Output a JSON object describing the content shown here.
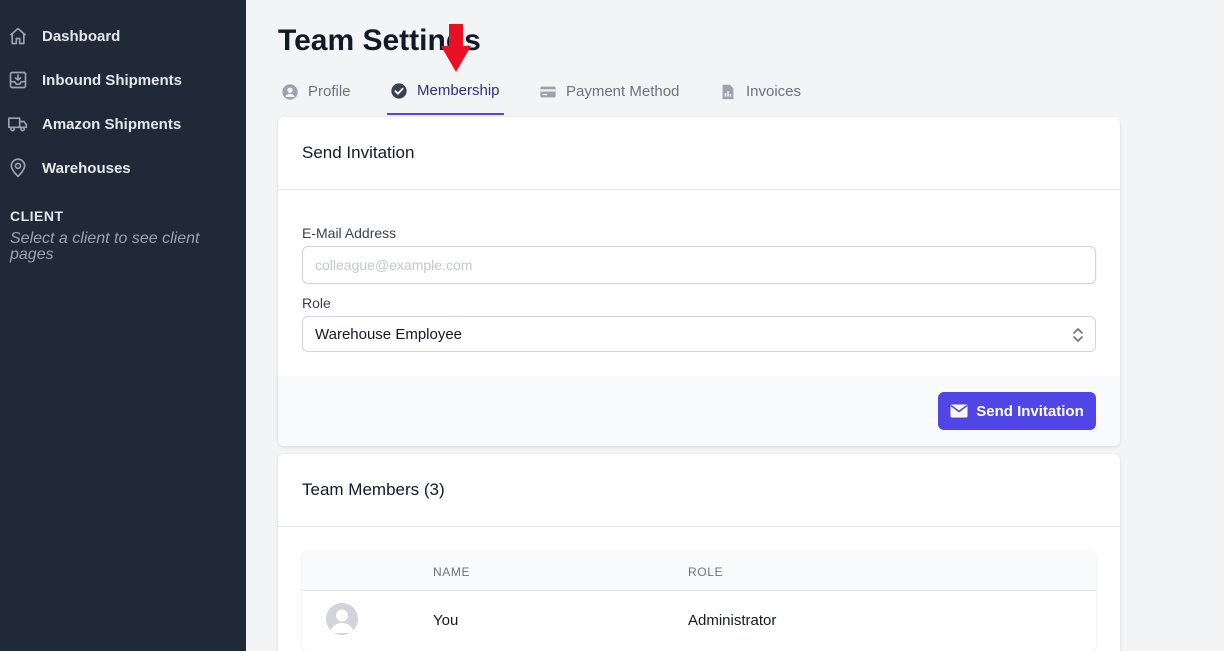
{
  "sidebar": {
    "items": [
      {
        "label": "Dashboard",
        "icon": "home-icon"
      },
      {
        "label": "Inbound Shipments",
        "icon": "inbox-download-icon"
      },
      {
        "label": "Amazon Shipments",
        "icon": "truck-icon"
      },
      {
        "label": "Warehouses",
        "icon": "location-pin-icon"
      }
    ],
    "client_heading": "CLIENT",
    "client_note": "Select a client to see client pages"
  },
  "page": {
    "title": "Team Settings"
  },
  "tabs": [
    {
      "label": "Profile",
      "icon": "user-circle-icon",
      "active": false
    },
    {
      "label": "Membership",
      "icon": "check-circle-icon",
      "active": true
    },
    {
      "label": "Payment Method",
      "icon": "credit-card-icon",
      "active": false
    },
    {
      "label": "Invoices",
      "icon": "document-chart-icon",
      "active": false
    }
  ],
  "invitation": {
    "title": "Send Invitation",
    "email_label": "E-Mail Address",
    "email_value": "",
    "email_placeholder": "colleague@example.com",
    "role_label": "Role",
    "role_value": "Warehouse Employee",
    "button_label": "Send Invitation"
  },
  "team": {
    "title": "Team Members (3)",
    "columns": [
      "NAME",
      "ROLE"
    ],
    "rows": [
      {
        "name": "You",
        "role": "Administrator"
      }
    ]
  },
  "colors": {
    "sidebar_bg": "#1f2937",
    "accent": "#5046e5",
    "annotation_arrow": "#e81123"
  }
}
